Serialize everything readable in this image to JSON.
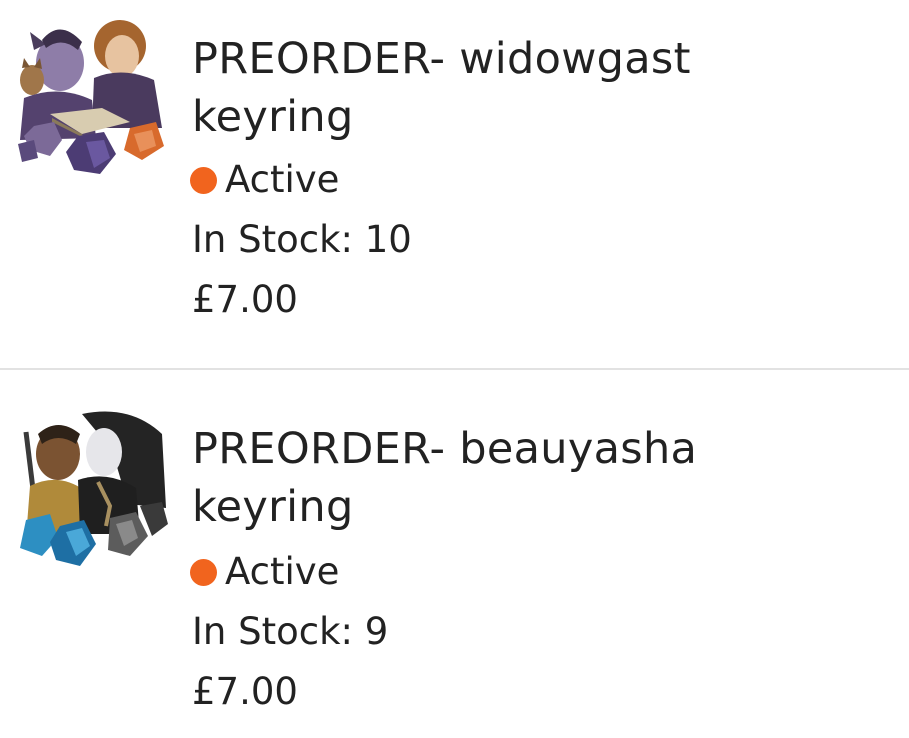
{
  "colors": {
    "active_dot": "#f1641e",
    "divider": "#e2e2e2",
    "text": "#222222"
  },
  "listings": [
    {
      "title": "PREORDER- widowgast\nkeyring",
      "status": "Active",
      "stock": "In Stock: 10",
      "price": "£7.00",
      "thumbnail_icon": "widowgast-keyring-image"
    },
    {
      "title": "PREORDER- beauyasha\nkeyring",
      "status": "Active",
      "stock": "In Stock: 9",
      "price": "£7.00",
      "thumbnail_icon": "beauyasha-keyring-image"
    }
  ]
}
